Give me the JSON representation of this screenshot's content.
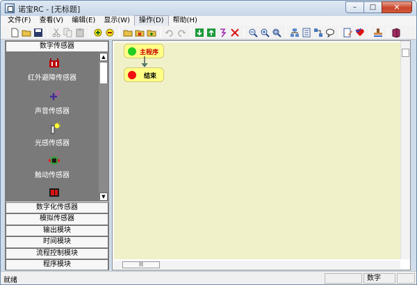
{
  "window": {
    "title": "诺宝RC - [无标题]",
    "controls": {
      "minimize": "–",
      "maximize": "□",
      "close": "✕"
    }
  },
  "menu": [
    "文件(F)",
    "查看(V)",
    "编辑(E)",
    "显示(W)",
    "操作(D)",
    "帮助(H)"
  ],
  "left_panel": {
    "header": "数字传感器",
    "sensors": [
      {
        "label": "红外避障传感器",
        "icon": "infrared-sensor-icon"
      },
      {
        "label": "声音传感器",
        "icon": "sound-sensor-icon"
      },
      {
        "label": "光感传感器",
        "icon": "light-sensor-icon"
      },
      {
        "label": "触动传感器",
        "icon": "touch-sensor-icon"
      },
      {
        "label": "",
        "icon": "sensor-icon-partial"
      }
    ],
    "categories": [
      "数字化传感器",
      "模拟传感器",
      "输出模块",
      "时间模块",
      "流程控制模块",
      "程序模块"
    ]
  },
  "canvas": {
    "nodes": [
      {
        "label": "主程序",
        "dot_color": "#22cc22",
        "text_color": "#cc0000"
      },
      {
        "label": "结束",
        "dot_color": "#ee1111",
        "text_color": "#000000"
      }
    ],
    "background": "#f0f1c9"
  },
  "status": {
    "main": "就绪",
    "mode": "数字"
  }
}
